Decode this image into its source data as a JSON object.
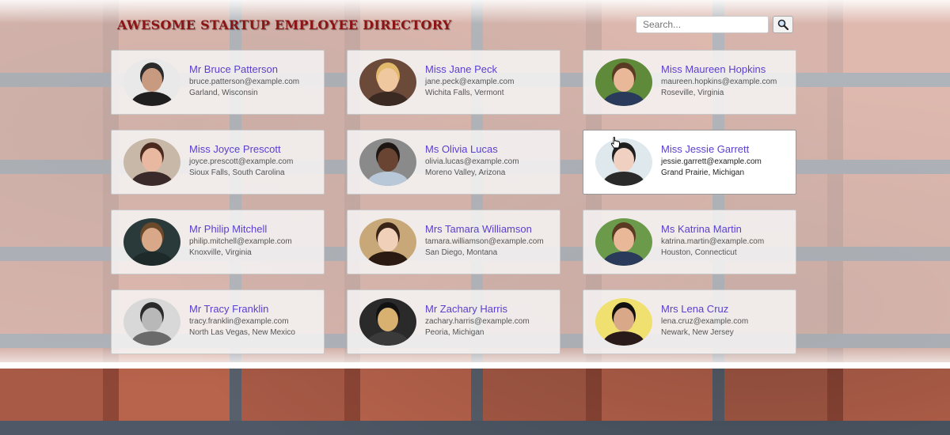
{
  "header": {
    "title": "AWESOME STARTUP EMPLOYEE DIRECTORY",
    "search_placeholder": "Search..."
  },
  "employees": [
    {
      "name": "Mr Bruce Patterson",
      "email": "bruce.patterson@example.com",
      "location": "Garland, Wisconsin",
      "bg": "#e9e9e9",
      "skin": "#c89a80",
      "hair": "#2a2a2a",
      "shirt": "#1f1f1f"
    },
    {
      "name": "Miss Jane Peck",
      "email": "jane.peck@example.com",
      "location": "Wichita Falls, Vermont",
      "bg": "#6b4a3a",
      "skin": "#f0c8a0",
      "hair": "#e2b86a",
      "shirt": "#3a2a22"
    },
    {
      "name": "Miss Maureen Hopkins",
      "email": "maureen.hopkins@example.com",
      "location": "Roseville, Virginia",
      "bg": "#5e8a3a",
      "skin": "#e8b898",
      "hair": "#5a3a22",
      "shirt": "#2a3a5a"
    },
    {
      "name": "Miss Joyce Prescott",
      "email": "joyce.prescott@example.com",
      "location": "Sioux Falls, South Carolina",
      "bg": "#c8b8a8",
      "skin": "#e8b8a0",
      "hair": "#4a2a1e",
      "shirt": "#3a2a2a"
    },
    {
      "name": "Ms Olivia Lucas",
      "email": "olivia.lucas@example.com",
      "location": "Moreno Valley, Arizona",
      "bg": "#8a8a8a",
      "skin": "#6a4432",
      "hair": "#1e1612",
      "shirt": "#b8c8d8"
    },
    {
      "name": "Miss Jessie Garrett",
      "email": "jessie.garrett@example.com",
      "location": "Grand Prairie, Michigan",
      "bg": "#dfe8ec",
      "skin": "#f0d0c0",
      "hair": "#1e1e1e",
      "shirt": "#2a2a2a"
    },
    {
      "name": "Mr Philip Mitchell",
      "email": "philip.mitchell@example.com",
      "location": "Knoxville, Virginia",
      "bg": "#2a3a3a",
      "skin": "#d8a888",
      "hair": "#6a4a2a",
      "shirt": "#1e2a2a"
    },
    {
      "name": "Mrs Tamara Williamson",
      "email": "tamara.williamson@example.com",
      "location": "San Diego, Montana",
      "bg": "#c8a878",
      "skin": "#f0d0b8",
      "hair": "#3a2418",
      "shirt": "#2a1a12"
    },
    {
      "name": "Ms Katrina Martin",
      "email": "katrina.martin@example.com",
      "location": "Houston, Connecticut",
      "bg": "#6a9a4a",
      "skin": "#e8b898",
      "hair": "#5a3a22",
      "shirt": "#2a3a5a"
    },
    {
      "name": "Mr Tracy Franklin",
      "email": "tracy.franklin@example.com",
      "location": "North Las Vegas, New Mexico",
      "bg": "#d8d8d8",
      "skin": "#b8b8b8",
      "hair": "#2a2a2a",
      "shirt": "#6a6a6a"
    },
    {
      "name": "Mr Zachary Harris",
      "email": "zachary.harris@example.com",
      "location": "Peoria, Michigan",
      "bg": "#2a2a2a",
      "skin": "#d8b070",
      "hair": "#121212",
      "shirt": "#3a3a3a"
    },
    {
      "name": "Mrs Lena Cruz",
      "email": "lena.cruz@example.com",
      "location": "Newark, New Jersey",
      "bg": "#f0e070",
      "skin": "#d8a888",
      "hair": "#141010",
      "shirt": "#2a1a1a"
    }
  ],
  "active_index": 5
}
